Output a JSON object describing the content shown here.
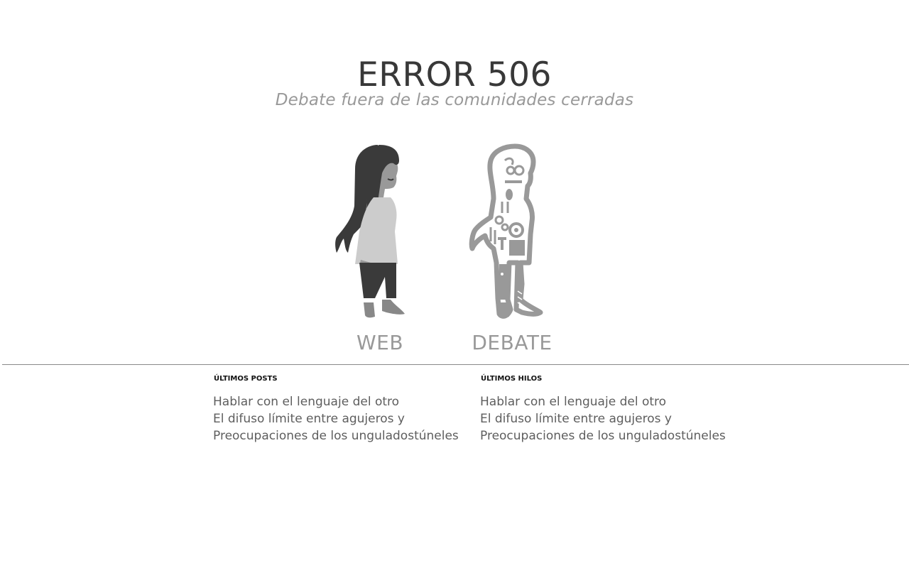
{
  "header": {
    "title": "ERROR 506",
    "subtitle": "Debate fuera de las comunidades cerradas"
  },
  "figures": {
    "web_label": "WEB",
    "debate_label": "DEBATE"
  },
  "colors": {
    "title": "#383838",
    "muted": "#999999",
    "link": "#5e5e5e",
    "dark_figure": "#3a3a3a",
    "light_figure": "#cccccc"
  },
  "posts": {
    "heading": "ÚLTIMOS POSTS",
    "items": [
      "Hablar con el lenguaje del otro",
      "El difuso límite entre agujeros y",
      "Preocupaciones de los unguladostúneles"
    ]
  },
  "hilos": {
    "heading": "ÚLTIMOS HILOS",
    "items": [
      "Hablar con el lenguaje del otro",
      "El difuso límite entre agujeros y",
      "Preocupaciones de los unguladostúneles"
    ]
  }
}
